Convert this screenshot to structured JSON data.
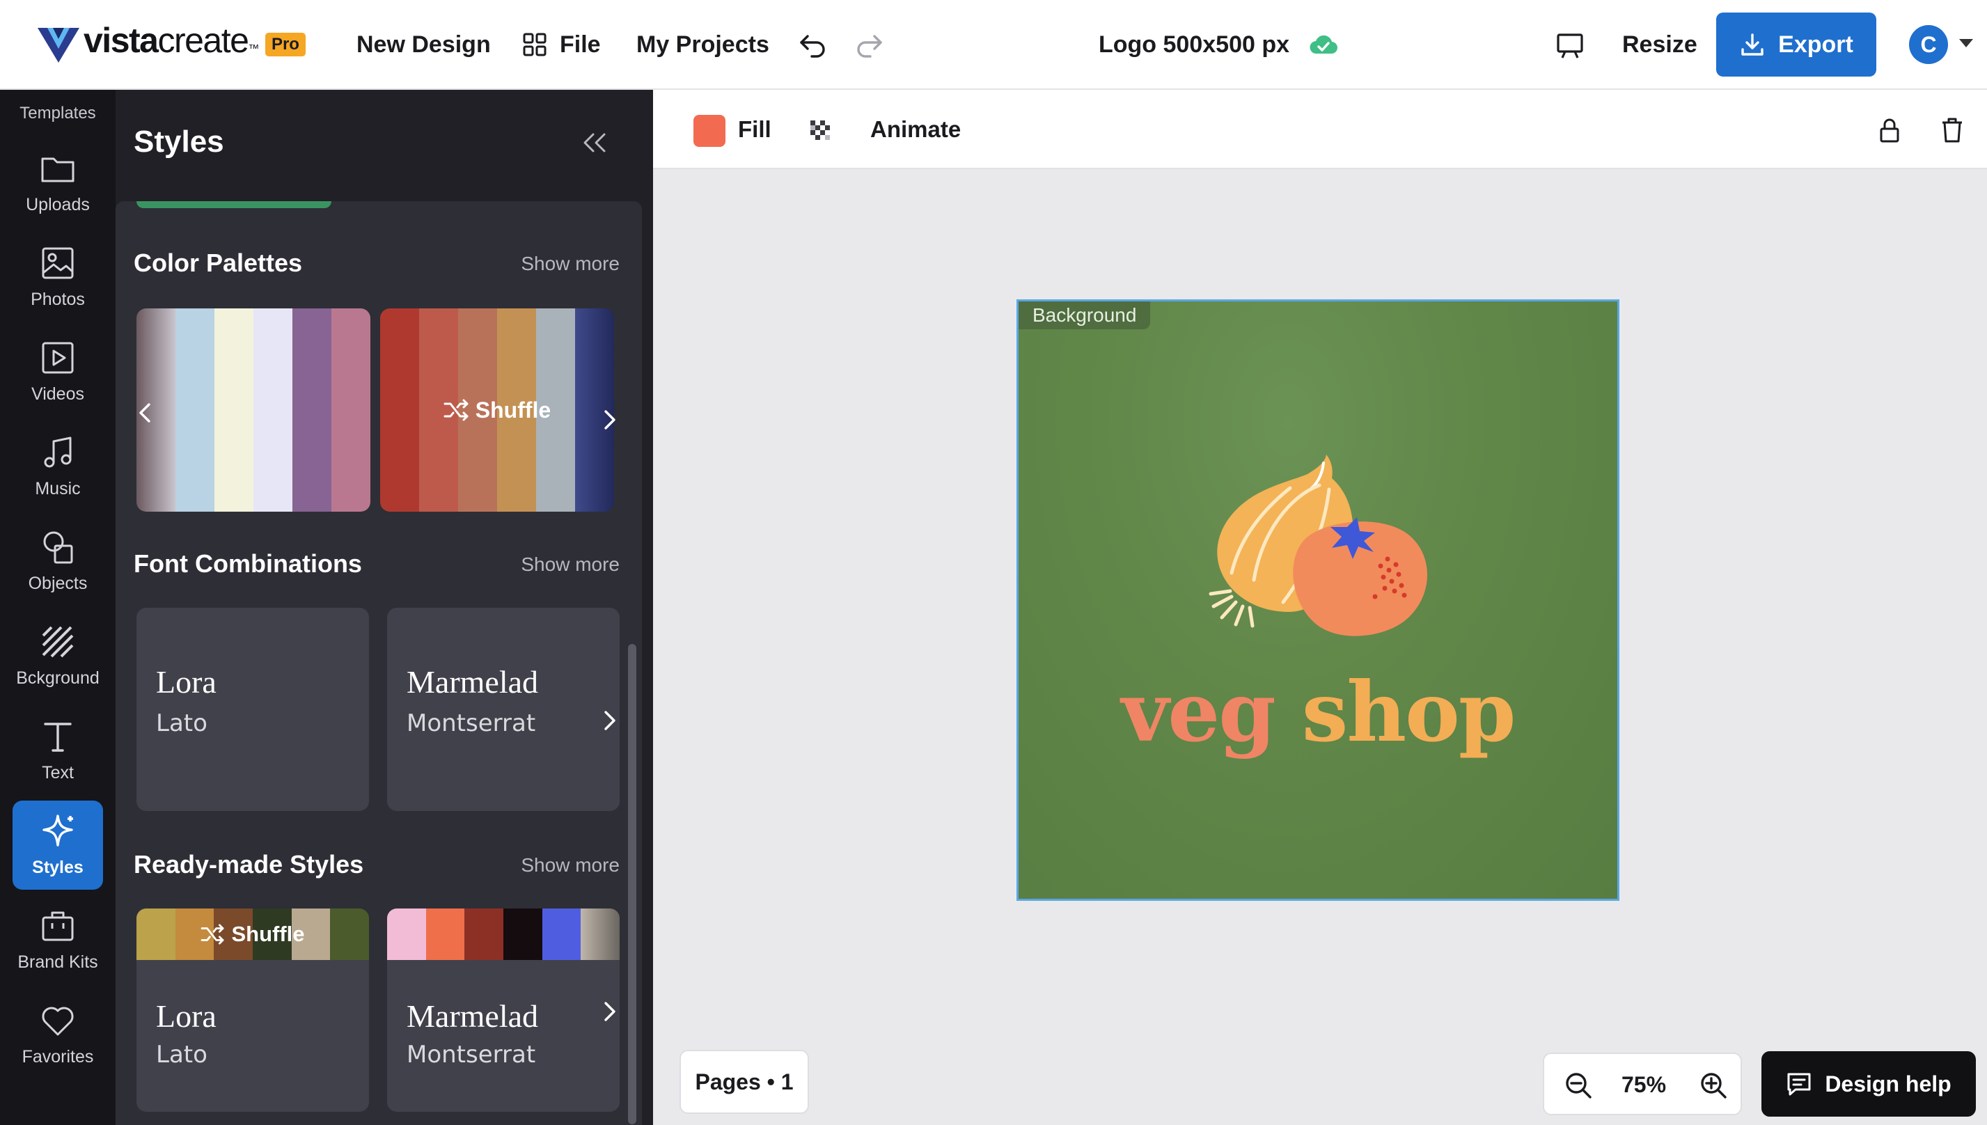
{
  "topbar": {
    "logo_bold": "vista",
    "logo_light": "create",
    "logo_tm": "™",
    "pro_badge": "Pro",
    "new_design": "New Design",
    "file": "File",
    "my_projects": "My Projects",
    "doc_title": "Logo 500x500 px",
    "resize": "Resize",
    "export": "Export",
    "avatar_initial": "C"
  },
  "rail": {
    "top_label": "Templates",
    "items": [
      {
        "label": "Uploads",
        "icon": "folder-icon"
      },
      {
        "label": "Photos",
        "icon": "image-icon"
      },
      {
        "label": "Videos",
        "icon": "play-icon"
      },
      {
        "label": "Music",
        "icon": "music-note-icon"
      },
      {
        "label": "Objects",
        "icon": "shapes-icon"
      },
      {
        "label": "Bckground",
        "icon": "hatch-icon"
      },
      {
        "label": "Text",
        "icon": "text-icon"
      },
      {
        "label": "Styles",
        "icon": "sparkle-icon"
      },
      {
        "label": "Brand Kits",
        "icon": "briefcase-icon"
      },
      {
        "label": "Favorites",
        "icon": "heart-icon"
      }
    ],
    "active": "Styles"
  },
  "panel": {
    "title": "Styles",
    "color_palettes": {
      "title": "Color Palettes",
      "show_more": "Show more",
      "shuffle_label": "Shuffle",
      "palettes": [
        [
          "#8a8f99",
          "#b9d2e4",
          "#f3f2dc",
          "#e6e6f6",
          "#876493",
          "#b9788f"
        ],
        [
          "#b0392f",
          "#bd5a4c",
          "#b9725a",
          "#c49154",
          "#a8b2b8",
          "#3f4a8c"
        ]
      ]
    },
    "font_combinations": {
      "title": "Font Combinations",
      "show_more": "Show more",
      "cards": [
        {
          "heading": "Lora",
          "body": "Lato"
        },
        {
          "heading": "Marmelad",
          "body": "Montserrat"
        }
      ]
    },
    "ready_made": {
      "title": "Ready-made Styles",
      "show_more": "Show more",
      "shuffle_label": "Shuffle",
      "cards": [
        {
          "heading": "Lora",
          "body": "Lato",
          "colors": [
            "#bca24a",
            "#c48a3e",
            "#7a4a2a",
            "#2e3a22",
            "#b9a990",
            "#4b5b2c"
          ]
        },
        {
          "heading": "Marmelad",
          "body": "Montserrat",
          "colors": [
            "#f2bcd6",
            "#ee6f4a",
            "#8c3026",
            "#150c10",
            "#4f5ee0",
            "#bfb6aa"
          ]
        }
      ]
    }
  },
  "toolbar2": {
    "fill": "Fill",
    "fill_color": "#f26b50",
    "animate": "Animate"
  },
  "canvas": {
    "tag": "Background",
    "word1": "veg",
    "word2": "shop",
    "bg_color": "#618749"
  },
  "footer": {
    "pages": "Pages • 1",
    "zoom": "75%",
    "design_help": "Design help"
  }
}
